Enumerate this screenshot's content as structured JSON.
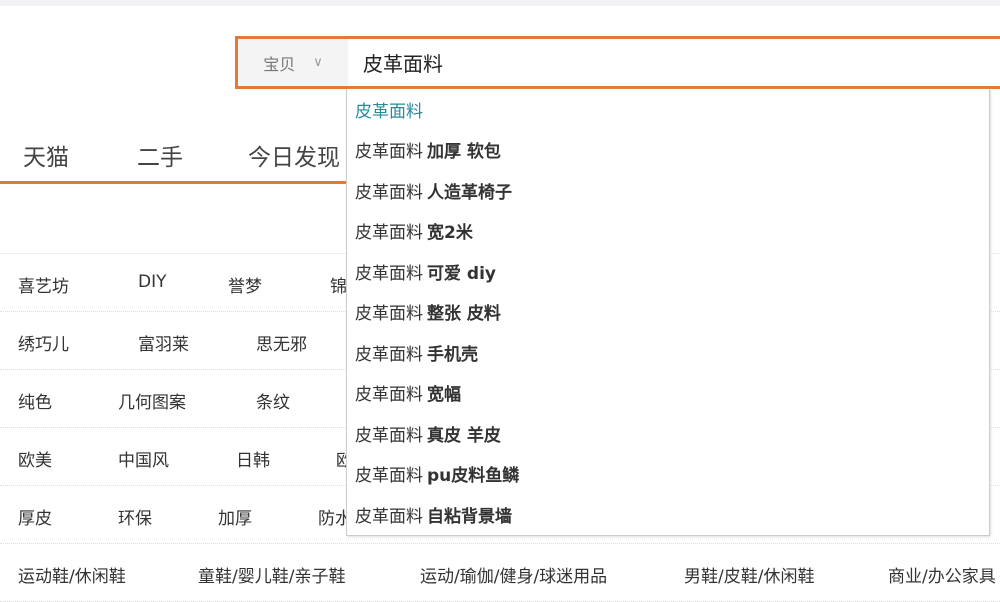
{
  "search": {
    "scope": "宝贝",
    "query": "皮革面料"
  },
  "tabs": [
    "天猫",
    "二手",
    "今日发现"
  ],
  "rows": [
    [
      "喜艺坊",
      "DIY",
      "誉梦",
      "锦"
    ],
    [
      "绣巧儿",
      "富羽莱",
      "思无邪"
    ],
    [
      "纯色",
      "几何图案",
      "条纹"
    ],
    [
      "欧美",
      "中国风",
      "日韩",
      "欧"
    ],
    [
      "厚皮",
      "环保",
      "加厚",
      "防水"
    ],
    [
      "运动鞋/休闲鞋",
      "童鞋/婴儿鞋/亲子鞋",
      "运动/瑜伽/健身/球迷用品",
      "男鞋/皮鞋/休闲鞋",
      "商业/办公家具"
    ]
  ],
  "suggestions": [
    {
      "prefix": "皮革面料",
      "suffix": ""
    },
    {
      "prefix": "皮革面料",
      "suffix": "加厚 软包"
    },
    {
      "prefix": "皮革面料",
      "suffix": "人造革椅子"
    },
    {
      "prefix": "皮革面料",
      "suffix": "宽2米"
    },
    {
      "prefix": "皮革面料",
      "suffix": "可爱 diy"
    },
    {
      "prefix": "皮革面料",
      "suffix": "整张 皮料"
    },
    {
      "prefix": "皮革面料",
      "suffix": "手机壳"
    },
    {
      "prefix": "皮革面料",
      "suffix": "宽幅"
    },
    {
      "prefix": "皮革面料",
      "suffix": "真皮 羊皮"
    },
    {
      "prefix": "皮革面料",
      "suffix": "pu皮料鱼鳞"
    },
    {
      "prefix": "皮革面料",
      "suffix": "自粘背景墙"
    }
  ],
  "colors": {
    "accent": "#e07a36",
    "suggestion_highlight": "#2a8a9a"
  }
}
